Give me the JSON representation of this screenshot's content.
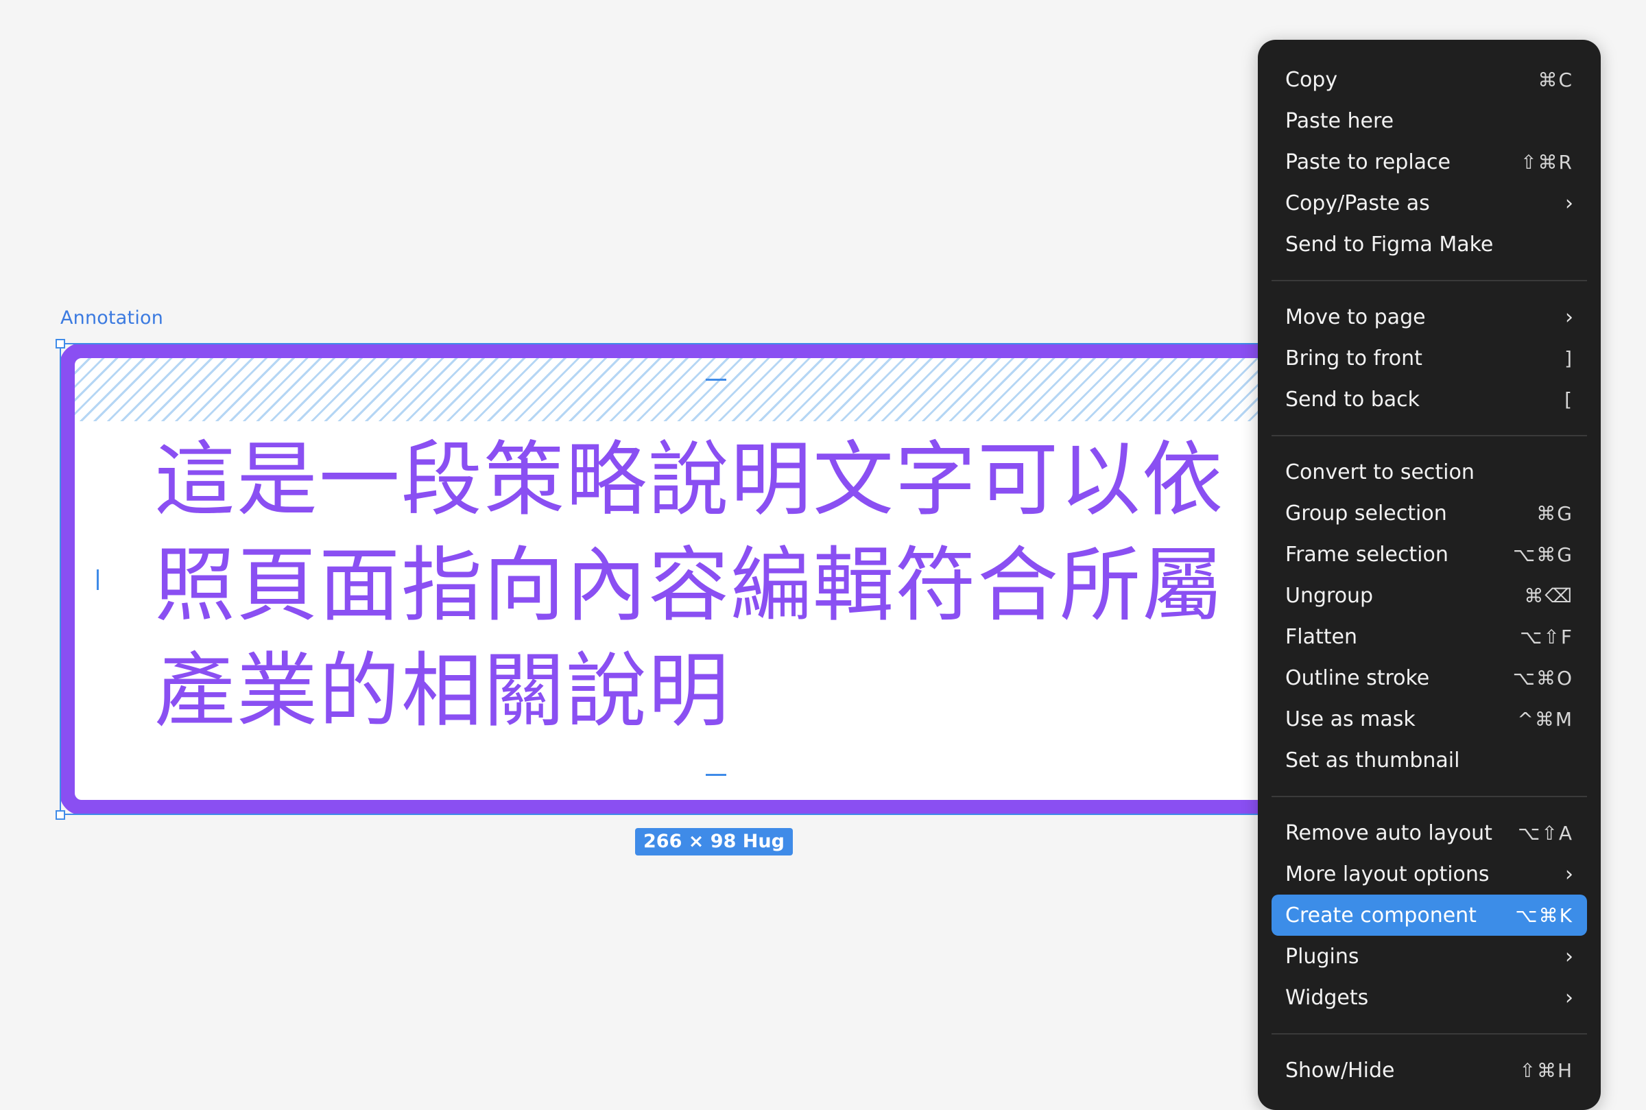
{
  "canvas": {
    "frame_label": "Annotation",
    "frame_text": "這是一段策略說明文字可以依照頁面指向內容編輯符合所屬產業的相關說明",
    "size_badge": "266 × 98 Hug"
  },
  "colors": {
    "accent": "#3f8be8",
    "frame_stroke": "#8a4ff2",
    "menu_bg": "#1f1f1f",
    "menu_highlight": "#3c8de8"
  },
  "menu": {
    "group1": [
      {
        "label": "Copy",
        "shortcut": "⌘C"
      },
      {
        "label": "Paste here",
        "shortcut": ""
      },
      {
        "label": "Paste to replace",
        "shortcut": "⇧⌘R"
      },
      {
        "label": "Copy/Paste as",
        "shortcut": "›"
      },
      {
        "label": "Send to Figma Make",
        "shortcut": ""
      }
    ],
    "group2": [
      {
        "label": "Move to page",
        "shortcut": "›"
      },
      {
        "label": "Bring to front",
        "shortcut": "]"
      },
      {
        "label": "Send to back",
        "shortcut": "["
      }
    ],
    "group3": [
      {
        "label": "Convert to section",
        "shortcut": ""
      },
      {
        "label": "Group selection",
        "shortcut": "⌘G"
      },
      {
        "label": "Frame selection",
        "shortcut": "⌥⌘G"
      },
      {
        "label": "Ungroup",
        "shortcut": "⌘⌫"
      },
      {
        "label": "Flatten",
        "shortcut": "⌥⇧F"
      },
      {
        "label": "Outline stroke",
        "shortcut": "⌥⌘O"
      },
      {
        "label": "Use as mask",
        "shortcut": "^⌘M"
      },
      {
        "label": "Set as thumbnail",
        "shortcut": ""
      }
    ],
    "group4": [
      {
        "label": "Remove auto layout",
        "shortcut": "⌥⇧A"
      },
      {
        "label": "More layout options",
        "shortcut": "›"
      },
      {
        "label": "Create component",
        "shortcut": "⌥⌘K"
      },
      {
        "label": "Plugins",
        "shortcut": "›"
      },
      {
        "label": "Widgets",
        "shortcut": "›"
      }
    ],
    "group5": [
      {
        "label": "Show/Hide",
        "shortcut": "⇧⌘H"
      }
    ]
  }
}
